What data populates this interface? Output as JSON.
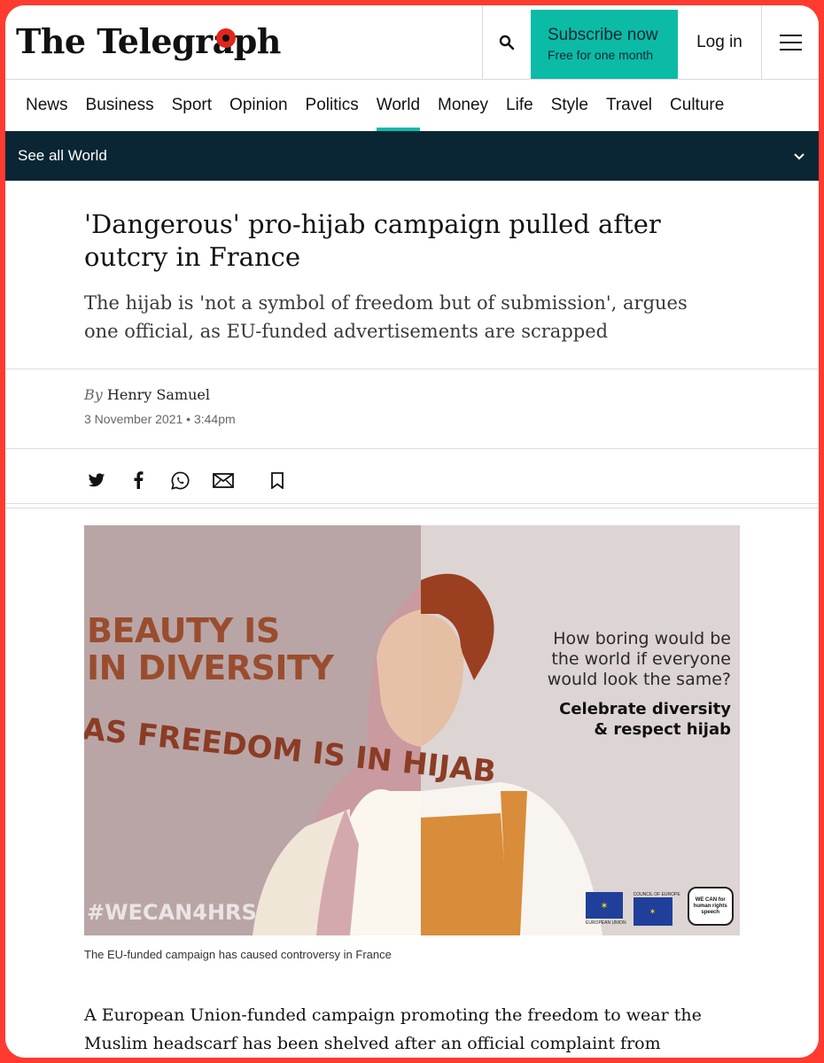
{
  "header": {
    "logo": "The Telegraph",
    "subscribe_title": "Subscribe now",
    "subscribe_sub": "Free for one month",
    "login": "Log in",
    "icons": {
      "search": "search-icon",
      "menu": "menu-icon"
    },
    "colors": {
      "accent": "#0bbba6",
      "navy": "#0a2634",
      "frame": "#ff3b30"
    }
  },
  "nav": {
    "items": [
      "News",
      "Business",
      "Sport",
      "Opinion",
      "Politics",
      "World",
      "Money",
      "Life",
      "Style",
      "Travel",
      "Culture"
    ],
    "active": "World"
  },
  "subnav": {
    "label": "See all World"
  },
  "article": {
    "headline": "'Dangerous' pro-hijab campaign pulled after outcry in France",
    "standfirst": "The hijab is 'not a symbol of freedom but of submission', argues one official, as EU-funded advertisements are scrapped",
    "byline_prefix": "By",
    "author": "Henry Samuel",
    "date": "3 November 2021 • 3:44pm",
    "share_icons": [
      "twitter-icon",
      "facebook-icon",
      "whatsapp-icon",
      "email-icon",
      "bookmark-icon"
    ],
    "image": {
      "headline_text_1": "BEAUTY IS",
      "headline_text_2": "IN DIVERSITY",
      "curved_text": "AS FREEDOM IS IN HIJAB",
      "hashtag": "#WECAN4HRS",
      "question": "How boring would be the world if everyone would look the same?",
      "call_to_action": "Celebrate diversity & respect hijab",
      "logo_labels": [
        "EUROPEAN UNION",
        "COUNCIL OF EUROPE",
        "WE CAN for human rights speech"
      ]
    },
    "caption": "The EU-funded campaign has caused controversy in France",
    "body": "A European Union-funded campaign promoting the freedom to wear the Muslim headscarf has been shelved after an official complaint from staunchly secular"
  }
}
